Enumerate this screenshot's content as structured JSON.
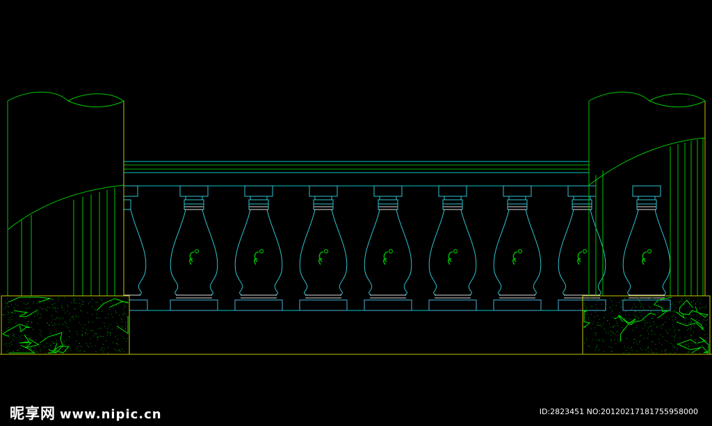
{
  "watermark": {
    "site_name": "昵享网",
    "site_url": "www.nipic.cn",
    "id_line": "ID:2823451 NO:20120217181755958000"
  },
  "drawing": {
    "subject": "balustrade elevation between two pillars",
    "baluster_count": 8,
    "colors": {
      "background": "#000000",
      "pillar_outline": "#00c800",
      "pillar_frame": "#c8c800",
      "rail_line": "#00c8c8",
      "rail_green": "#00b400",
      "baluster_body": "#2fc3d2",
      "baluster_base": "#46b4dc",
      "ring_white": "#dcdcdc",
      "stone_crack": "#00e000",
      "stone_dots": "#00a000"
    }
  }
}
